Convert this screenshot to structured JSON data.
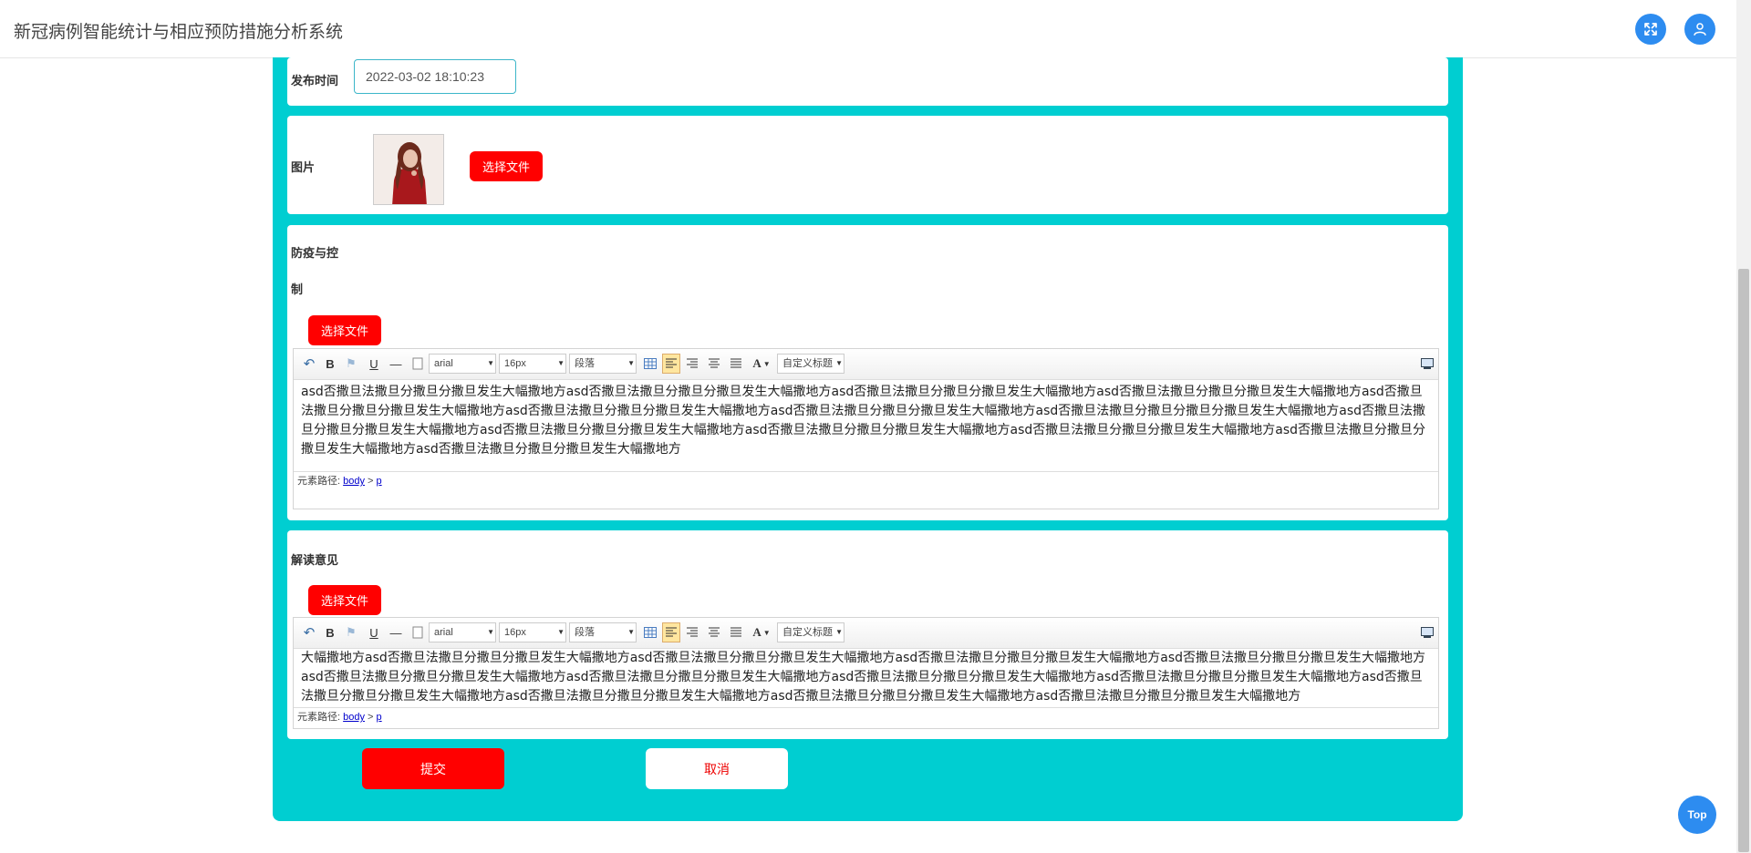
{
  "header": {
    "title": "新冠病例智能统计与相应预防措施分析系统",
    "fullscreen_icon": "expand-icon",
    "user_icon": "user-icon"
  },
  "form": {
    "publish_time": {
      "label": "发布时间",
      "value": "2022-03-02 18:10:23"
    },
    "image": {
      "label": "图片",
      "choose_label": "选择文件"
    },
    "prevention": {
      "label_line1": "防疫与控",
      "label_line2": "制",
      "choose_label": "选择文件",
      "content": "asd否撒旦法撒旦分撒旦分撒旦发生大幅撒地方asd否撒旦法撒旦分撒旦分撒旦发生大幅撒地方asd否撒旦法撒旦分撒旦分撒旦发生大幅撒地方asd否撒旦法撒旦分撒旦分撒旦发生大幅撒地方asd否撒旦法撒旦分撒旦分撒旦发生大幅撒地方asd否撒旦法撒旦分撒旦分撒旦发生大幅撒地方asd否撒旦法撒旦分撒旦分撒旦发生大幅撒地方asd否撒旦法撒旦分撒旦分撒旦分撒旦发生大幅撒地方asd否撒旦法撒旦分撒旦分撒旦发生大幅撒地方asd否撒旦法撒旦分撒旦分撒旦发生大幅撒地方asd否撒旦法撒旦分撒旦分撒旦发生大幅撒地方asd否撒旦法撒旦分撒旦分撒旦发生大幅撒地方asd否撒旦法撒旦分撒旦分撒旦发生大幅撒地方asd否撒旦法撒旦分撒旦分撒旦发生大幅撒地方",
      "status_prefix": "元素路径: ",
      "path_body": "body",
      "path_sep": " > ",
      "path_p": "p"
    },
    "interpretation": {
      "label": "解读意见",
      "choose_label": "选择文件",
      "content": "大幅撒地方asd否撒旦法撒旦分撒旦分撒旦发生大幅撒地方asd否撒旦法撒旦分撒旦分撒旦发生大幅撒地方asd否撒旦法撒旦分撒旦分撒旦发生大幅撒地方asd否撒旦法撒旦分撒旦分撒旦发生大幅撒地方asd否撒旦法撒旦分撒旦分撒旦发生大幅撒地方asd否撒旦法撒旦分撒旦分撒旦发生大幅撒地方asd否撒旦法撒旦分撒旦分撒旦发生大幅撒地方asd否撒旦法撒旦分撒旦分撒旦发生大幅撒地方asd否撒旦法撒旦分撒旦分撒旦发生大幅撒地方asd否撒旦法撒旦分撒旦分撒旦发生大幅撒地方asd否撒旦法撒旦分撒旦分撒旦发生大幅撒地方asd否撒旦法撒旦分撒旦分撒旦发生大幅撒地方",
      "status_prefix": "元素路径: ",
      "path_body": "body",
      "path_sep": " > ",
      "path_p": "p"
    }
  },
  "toolbar": {
    "bold": "B",
    "underline": "U",
    "hr": "—",
    "font_family": "arial",
    "font_size": "16px",
    "paragraph": "段落",
    "font_color": "A",
    "custom_title": "自定义标题"
  },
  "actions": {
    "submit": "提交",
    "cancel": "取消"
  },
  "back_to_top": "Top",
  "colors": {
    "accent": "#00ced1",
    "primary_button": "#ff0000",
    "round_button": "#2d8cf0"
  }
}
